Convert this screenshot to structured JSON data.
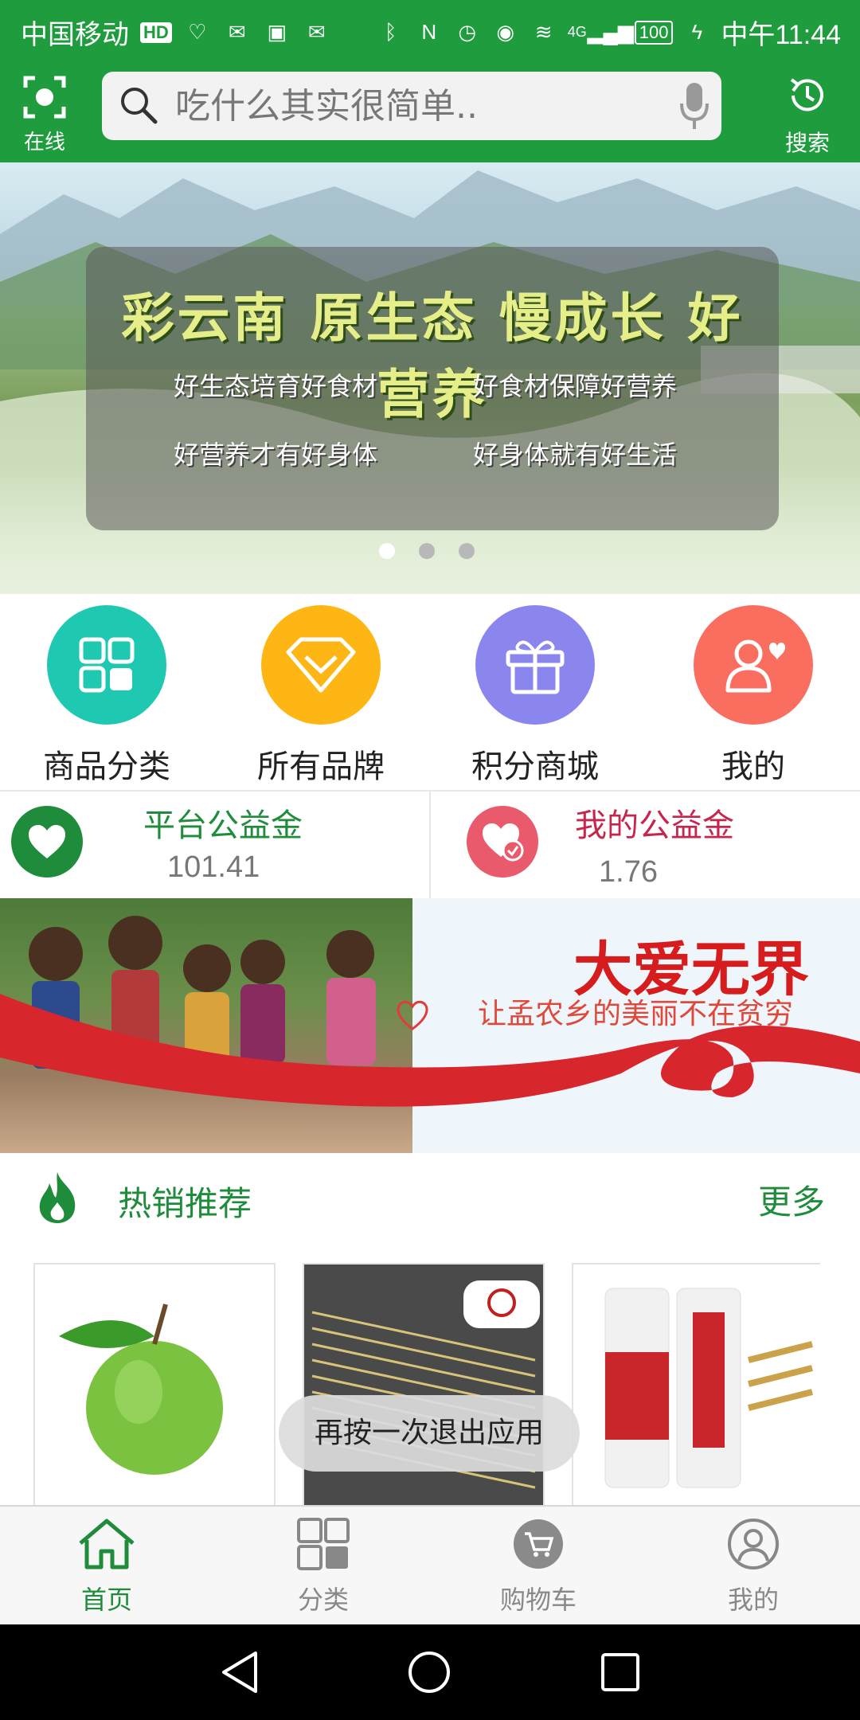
{
  "status_bar": {
    "carrier": "中国移动",
    "hd_badge": "HD",
    "network": "4G",
    "battery": "100",
    "time": "中午11:44",
    "icons": [
      "heartbeat-icon",
      "mail-icon",
      "app-icon",
      "mail-outline-icon",
      "bluetooth-icon",
      "nfc-icon",
      "alarm-icon",
      "eye-icon",
      "wifi-icon",
      "signal-icon",
      "battery-icon",
      "charging-icon"
    ]
  },
  "header": {
    "scan_label": "在线",
    "search_placeholder": "吃什么其实很简单..",
    "search_label": "搜索"
  },
  "hero": {
    "title": "彩云南 原生态 慢成长 好营养",
    "lines": [
      "好生态培育好食材",
      "好食材保障好营养",
      "好营养才有好身体",
      "好身体就有好生活"
    ],
    "slide_count": 3,
    "active_slide": 0
  },
  "quick_nav": [
    {
      "label": "商品分类",
      "icon": "grid-icon",
      "color": "#1fc9b1"
    },
    {
      "label": "所有品牌",
      "icon": "diamond-icon",
      "color": "#fdb614"
    },
    {
      "label": "积分商城",
      "icon": "gift-icon",
      "color": "#8a86ee"
    },
    {
      "label": "我的",
      "icon": "user-heart-icon",
      "color": "#fa6e60"
    }
  ],
  "welfare": {
    "platform": {
      "title": "平台公益金",
      "value": "101.41",
      "color": "#1e8c3a"
    },
    "mine": {
      "title": "我的公益金",
      "value": "1.76",
      "color": "#c6254c"
    }
  },
  "charity_banner": {
    "title": "大爱无界",
    "subtitle": "让孟农乡的美丽不在贫穷"
  },
  "hot": {
    "title": "热销推荐",
    "more": "更多"
  },
  "toast": "再按一次退出应用",
  "tabbar": [
    {
      "label": "首页",
      "icon": "home-icon",
      "active": true
    },
    {
      "label": "分类",
      "icon": "category-icon",
      "active": false
    },
    {
      "label": "购物车",
      "icon": "cart-icon",
      "active": false
    },
    {
      "label": "我的",
      "icon": "profile-icon",
      "active": false
    }
  ],
  "colors": {
    "brand_green": "#1e9c3e",
    "text_green": "#1e8c3a",
    "welfare_red": "#c6254c"
  }
}
